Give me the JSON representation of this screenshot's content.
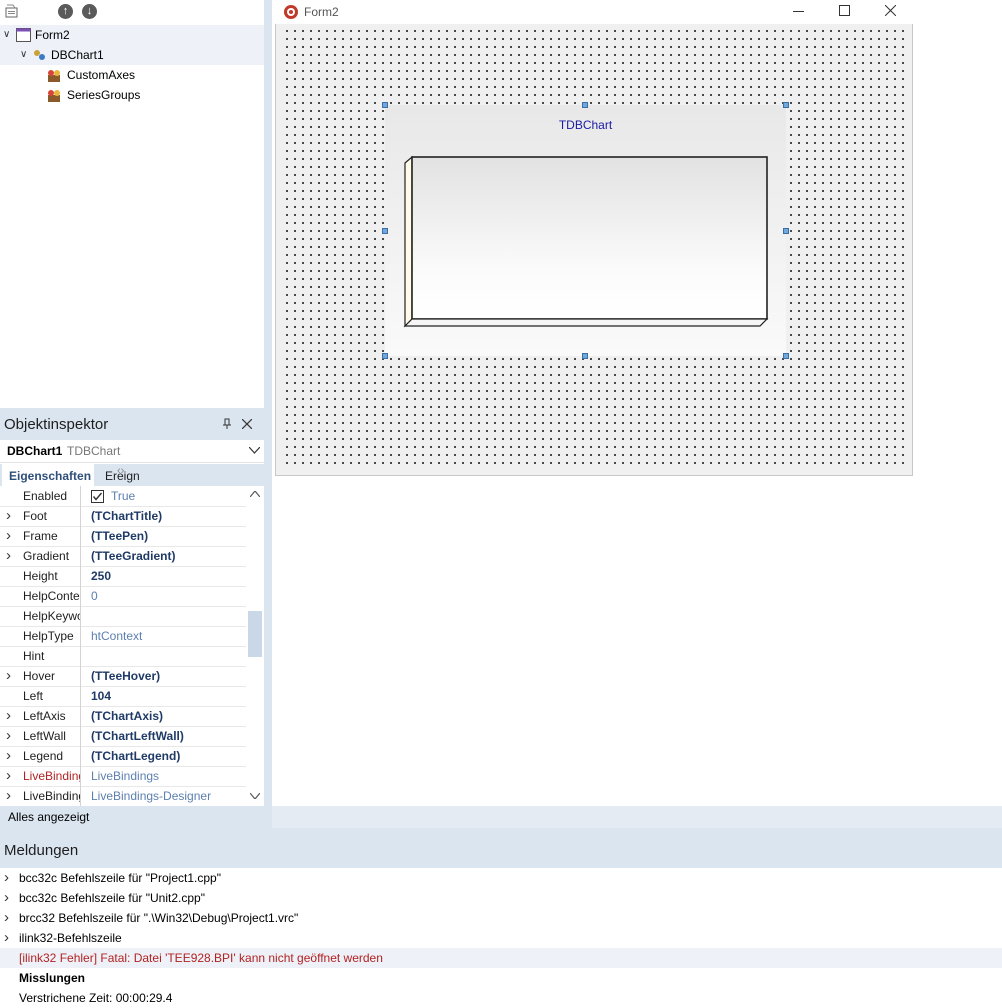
{
  "structure": {
    "items": [
      {
        "label": "Form2"
      },
      {
        "label": "DBChart1"
      },
      {
        "label": "CustomAxes"
      },
      {
        "label": "SeriesGroups"
      }
    ]
  },
  "inspector": {
    "title": "Objektinspektor",
    "object_name": "DBChart1",
    "object_type": "TDBChart",
    "tab_properties": "Eigenschaften",
    "tab_events": "Ereign",
    "status": "Alles angezeigt",
    "properties": [
      {
        "name": "Enabled",
        "value": "True",
        "style": "light",
        "expand": false,
        "check": true
      },
      {
        "name": "Foot",
        "value": "(TChartTitle)",
        "style": "bold",
        "expand": true
      },
      {
        "name": "Frame",
        "value": "(TTeePen)",
        "style": "bold",
        "expand": true
      },
      {
        "name": "Gradient",
        "value": "(TTeeGradient)",
        "style": "bold",
        "expand": true
      },
      {
        "name": "Height",
        "value": "250",
        "style": "bold",
        "expand": false
      },
      {
        "name": "HelpContext",
        "value": "0",
        "style": "light",
        "expand": false
      },
      {
        "name": "HelpKeyword",
        "value": "",
        "style": "light",
        "expand": false
      },
      {
        "name": "HelpType",
        "value": "htContext",
        "style": "light",
        "expand": false
      },
      {
        "name": "Hint",
        "value": "",
        "style": "light",
        "expand": false
      },
      {
        "name": "Hover",
        "value": "(TTeeHover)",
        "style": "bold",
        "expand": true
      },
      {
        "name": "Left",
        "value": "104",
        "style": "bold",
        "expand": false
      },
      {
        "name": "LeftAxis",
        "value": "(TChartAxis)",
        "style": "bold",
        "expand": true
      },
      {
        "name": "LeftWall",
        "value": "(TChartLeftWall)",
        "style": "bold",
        "expand": true
      },
      {
        "name": "Legend",
        "value": "(TChartLegend)",
        "style": "bold",
        "expand": true
      },
      {
        "name": "LiveBindings",
        "value": "LiveBindings",
        "style": "light",
        "expand": true,
        "red": true
      },
      {
        "name": "LiveBindings Designer",
        "value": "LiveBindings-Designer",
        "style": "light",
        "expand": true
      }
    ]
  },
  "form": {
    "title": "Form2",
    "chart_title": "TDBChart"
  },
  "messages": {
    "title": "Meldungen",
    "items": [
      {
        "text": "bcc32c Befehlszeile für \"Project1.cpp\"",
        "type": "expand"
      },
      {
        "text": "bcc32c Befehlszeile für \"Unit2.cpp\"",
        "type": "expand"
      },
      {
        "text": "brcc32 Befehlszeile für \".\\Win32\\Debug\\Project1.vrc\"",
        "type": "expand"
      },
      {
        "text": "ilink32-Befehlszeile",
        "type": "expand"
      },
      {
        "text": "[ilink32 Fehler] Fatal: Datei 'TEE928.BPI' kann nicht geöffnet werden",
        "type": "error"
      },
      {
        "text": "Misslungen",
        "type": "bold"
      },
      {
        "text": "Verstrichene Zeit: 00:00:29.4",
        "type": "plain"
      }
    ]
  },
  "colors": {
    "panel_header": "#dbe5f0",
    "error_text": "#b22222",
    "value_bold": "#1f3a66",
    "value_light": "#5c7fb0",
    "chart_title": "#1a1aa6"
  }
}
